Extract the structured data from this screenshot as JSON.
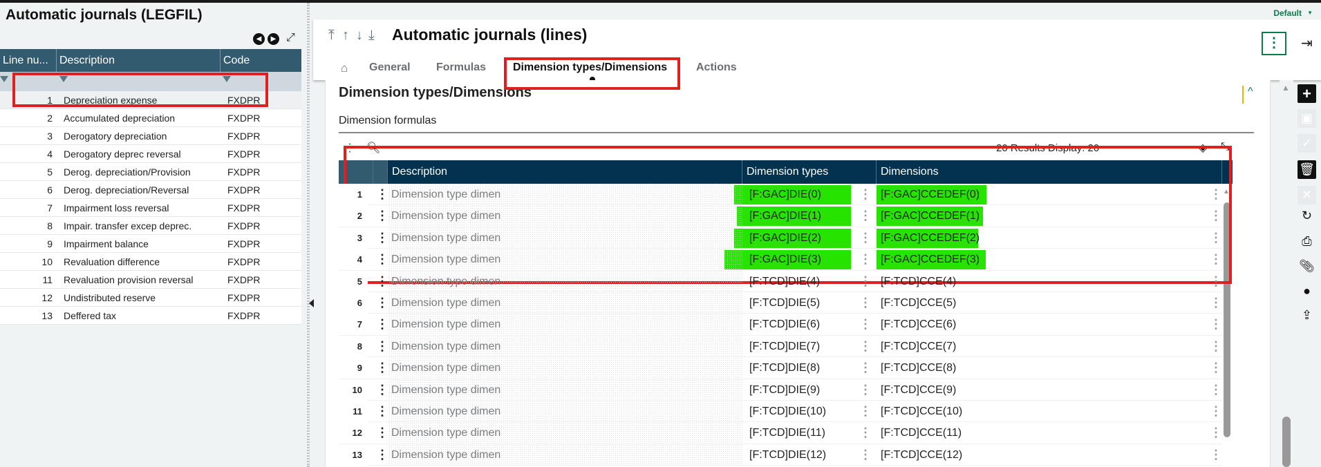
{
  "left_panel": {
    "title": "Automatic journals (LEGFIL)",
    "columns": [
      "Line nu...",
      "Description",
      "Code"
    ],
    "rows": [
      {
        "line": "1",
        "description": "Depreciation expense",
        "code": "FXDPR"
      },
      {
        "line": "2",
        "description": "Accumulated depreciation",
        "code": "FXDPR"
      },
      {
        "line": "3",
        "description": "Derogatory depreciation",
        "code": "FXDPR"
      },
      {
        "line": "4",
        "description": "Derogatory deprec reversal",
        "code": "FXDPR"
      },
      {
        "line": "5",
        "description": "Derog. depreciation/Provision",
        "code": "FXDPR"
      },
      {
        "line": "6",
        "description": "Derog. depreciation/Reversal",
        "code": "FXDPR"
      },
      {
        "line": "7",
        "description": "Impairment loss reversal",
        "code": "FXDPR"
      },
      {
        "line": "8",
        "description": "Impair. transfer excep deprec.",
        "code": "FXDPR"
      },
      {
        "line": "9",
        "description": "Impairment balance",
        "code": "FXDPR"
      },
      {
        "line": "10",
        "description": "Revaluation difference",
        "code": "FXDPR"
      },
      {
        "line": "11",
        "description": "Revaluation provision reversal",
        "code": "FXDPR"
      },
      {
        "line": "12",
        "description": "Undistributed reserve",
        "code": "FXDPR"
      },
      {
        "line": "13",
        "description": "Deffered tax",
        "code": "FXDPR"
      }
    ]
  },
  "top": {
    "profile": "Default"
  },
  "header": {
    "title": "Automatic journals (lines)",
    "tabs": [
      "General",
      "Formulas",
      "Dimension types/Dimensions",
      "Actions"
    ],
    "active_tab": "Dimension types/Dimensions"
  },
  "section": {
    "title": "Dimension types/Dimensions",
    "subtitle": "Dimension formulas",
    "results": "20 Results  Display:  20"
  },
  "grid": {
    "columns": [
      "Description",
      "Dimension types",
      "Dimensions"
    ],
    "rows": [
      {
        "n": "1",
        "description": "Dimension type dimen",
        "type": "[F:GAC]DIE(0)",
        "dim": "[F:GAC]CCEDEF(0)",
        "highlight": true
      },
      {
        "n": "2",
        "description": "Dimension type dimen",
        "type": "[F:GAC]DIE(1)",
        "dim": "[F:GAC]CCEDEF(1)",
        "highlight": true
      },
      {
        "n": "3",
        "description": "Dimension type dimen",
        "type": "[F:GAC]DIE(2)",
        "dim": "[F:GAC]CCEDEF(2)",
        "highlight": true
      },
      {
        "n": "4",
        "description": "Dimension type dimen",
        "type": "[F:GAC]DIE(3)",
        "dim": "[F:GAC]CCEDEF(3)",
        "highlight": true
      },
      {
        "n": "5",
        "description": "Dimension type dimen",
        "type": "[F:TCD]DIE(4)",
        "dim": "[F:TCD]CCE(4)"
      },
      {
        "n": "6",
        "description": "Dimension type dimen",
        "type": "[F:TCD]DIE(5)",
        "dim": "[F:TCD]CCE(5)"
      },
      {
        "n": "7",
        "description": "Dimension type dimen",
        "type": "[F:TCD]DIE(6)",
        "dim": "[F:TCD]CCE(6)"
      },
      {
        "n": "8",
        "description": "Dimension type dimen",
        "type": "[F:TCD]DIE(7)",
        "dim": "[F:TCD]CCE(7)"
      },
      {
        "n": "9",
        "description": "Dimension type dimen",
        "type": "[F:TCD]DIE(8)",
        "dim": "[F:TCD]CCE(8)"
      },
      {
        "n": "10",
        "description": "Dimension type dimen",
        "type": "[F:TCD]DIE(9)",
        "dim": "[F:TCD]CCE(9)"
      },
      {
        "n": "11",
        "description": "Dimension type dimen",
        "type": "[F:TCD]DIE(10)",
        "dim": "[F:TCD]CCE(10)"
      },
      {
        "n": "12",
        "description": "Dimension type dimen",
        "type": "[F:TCD]DIE(11)",
        "dim": "[F:TCD]CCE(11)"
      },
      {
        "n": "13",
        "description": "Dimension type dimen",
        "type": "[F:TCD]DIE(12)",
        "dim": "[F:TCD]CCE(12)"
      }
    ]
  },
  "colors": {
    "header": "#02324d",
    "left_header": "#335b70",
    "highlight": "#26e400",
    "accent": "#0d7a4a",
    "annotation": "#e0201f"
  },
  "right_toolbar_icons": [
    "plus-icon",
    "save-icon",
    "check-icon",
    "trash-icon",
    "close-icon",
    "refresh-icon",
    "print-icon",
    "attachment-icon",
    "comment-icon",
    "share-icon"
  ]
}
